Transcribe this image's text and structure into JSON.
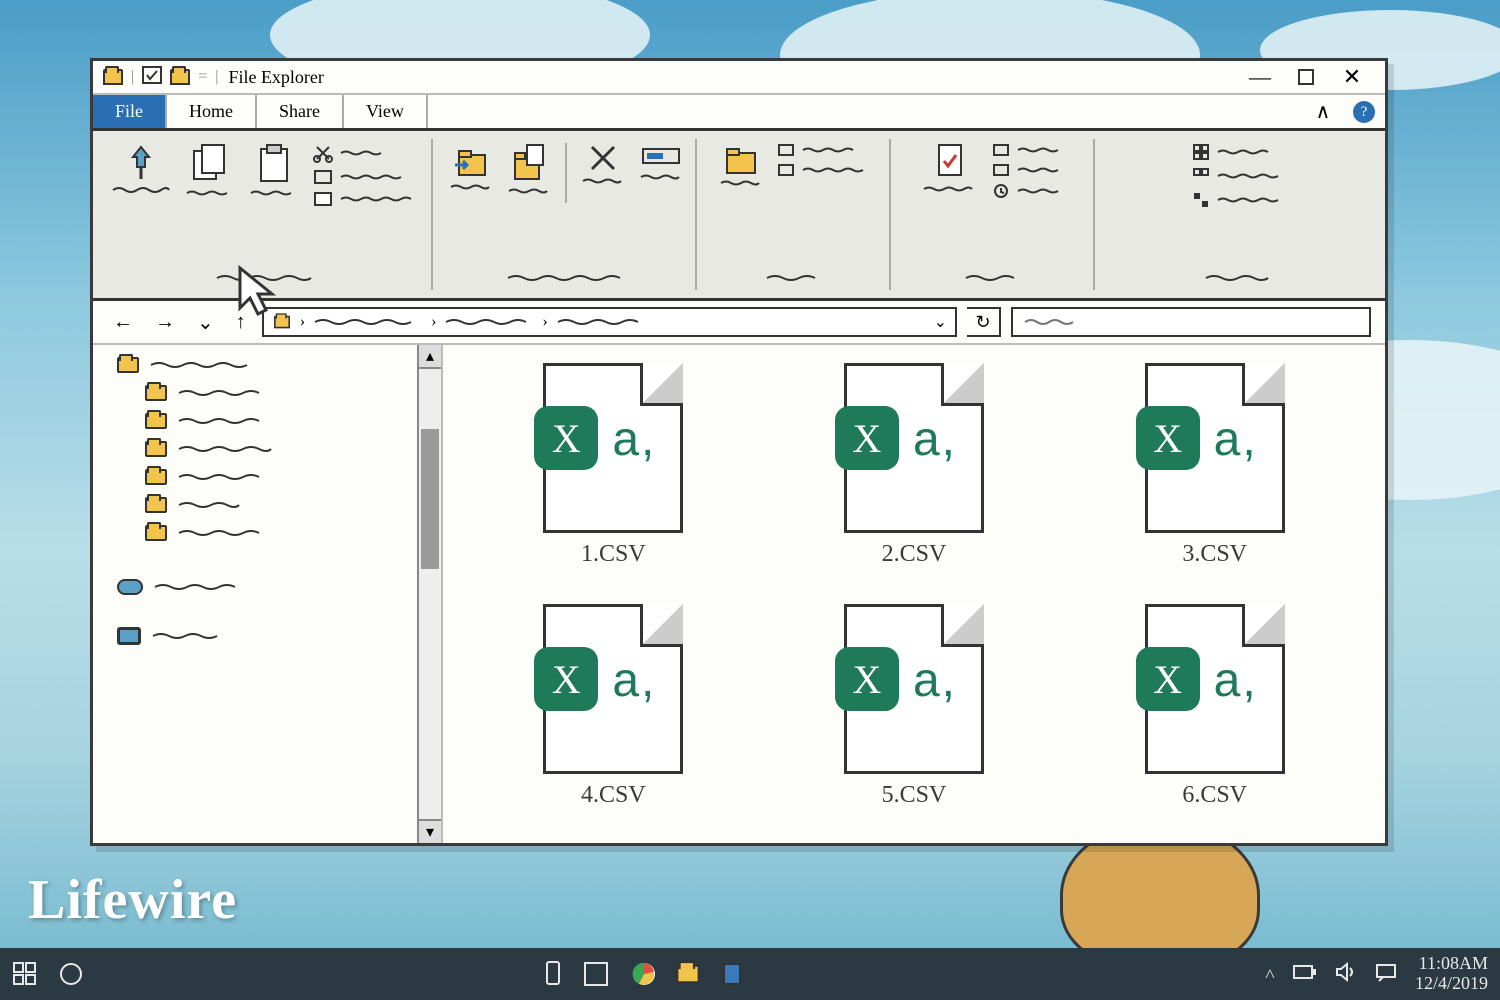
{
  "brand": "Lifewire",
  "window": {
    "title": "File Explorer",
    "tabs": {
      "file": "File",
      "home": "Home",
      "share": "Share",
      "view": "View",
      "active": "file"
    }
  },
  "files": [
    {
      "name": "1.CSV"
    },
    {
      "name": "2.CSV"
    },
    {
      "name": "3.CSV"
    },
    {
      "name": "4.CSV"
    },
    {
      "name": "5.CSV"
    },
    {
      "name": "6.CSV"
    }
  ],
  "taskbar": {
    "time": "11:08AM",
    "date": "12/4/2019"
  },
  "icon_labels": {
    "csv_badge": "X",
    "csv_suffix": "a,"
  }
}
